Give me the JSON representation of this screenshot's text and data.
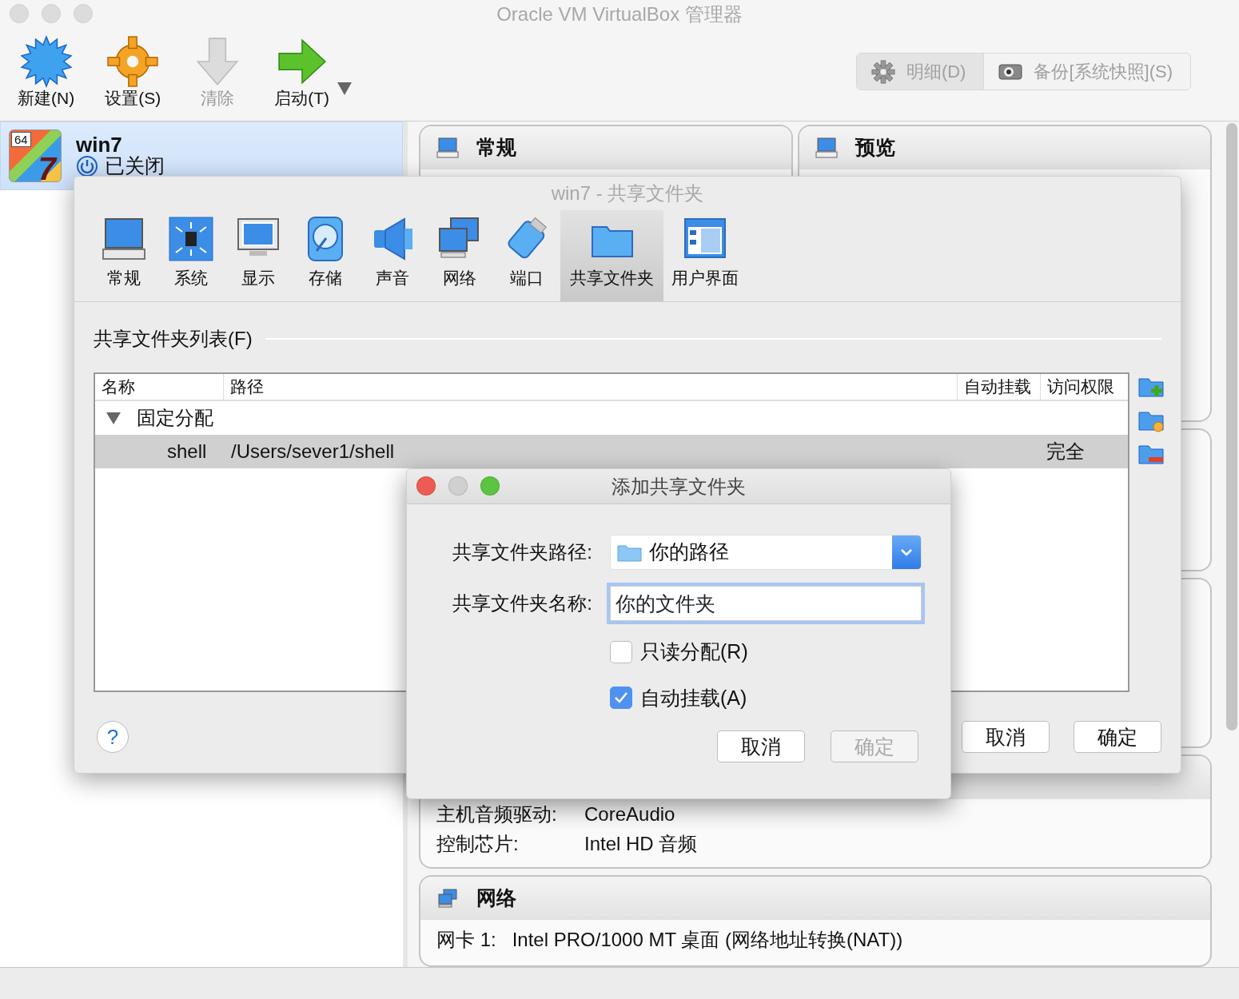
{
  "window": {
    "title": "Oracle VM VirtualBox 管理器"
  },
  "toolbar": [
    {
      "label": "新建(N)",
      "disabled": false,
      "kind": "new"
    },
    {
      "label": "设置(S)",
      "disabled": false,
      "kind": "settings"
    },
    {
      "label": "清除",
      "disabled": true,
      "kind": "discard"
    },
    {
      "label": "启动(T)",
      "disabled": false,
      "kind": "start",
      "menu": true
    }
  ],
  "mode_tabs": [
    {
      "label": "明细(D)",
      "selected": true,
      "kind": "gear"
    },
    {
      "label": "备份[系统快照](S)",
      "selected": false,
      "kind": "camera"
    }
  ],
  "vm_list": [
    {
      "name": "win7",
      "badge": "64",
      "logo": "7",
      "state": "已关闭",
      "selected": true
    }
  ],
  "details": {
    "general": {
      "title": "常规"
    },
    "preview": {
      "title": "预览"
    },
    "audio": {
      "rows": [
        {
          "label": "主机音频驱动:",
          "value": "CoreAudio"
        },
        {
          "label": "控制芯片:",
          "value": "Intel HD 音频"
        }
      ]
    },
    "network": {
      "title": "网络",
      "rows": [
        {
          "label": "网卡 1:",
          "value": "Intel PRO/1000 MT 桌面 (网络地址转换(NAT))"
        }
      ]
    }
  },
  "settings_dialog": {
    "title": "win7 - 共享文件夹",
    "sections": [
      {
        "label": "常规",
        "selected": false,
        "kind": "general"
      },
      {
        "label": "系统",
        "selected": false,
        "kind": "system"
      },
      {
        "label": "显示",
        "selected": false,
        "kind": "display"
      },
      {
        "label": "存储",
        "selected": false,
        "kind": "storage"
      },
      {
        "label": "声音",
        "selected": false,
        "kind": "audio"
      },
      {
        "label": "网络",
        "selected": false,
        "kind": "network"
      },
      {
        "label": "端口",
        "selected": false,
        "kind": "ports"
      },
      {
        "label": "共享文件夹",
        "selected": true,
        "kind": "shared"
      },
      {
        "label": "用户界面",
        "selected": false,
        "kind": "ui"
      }
    ],
    "list_title": "共享文件夹列表(F)",
    "columns": [
      "名称",
      "路径",
      "自动挂载",
      "访问权限"
    ],
    "groups": [
      {
        "label": "固定分配",
        "expanded": true,
        "rows": [
          {
            "name": "shell",
            "path": "/Users/sever1/shell",
            "access": "完全",
            "selected": true
          }
        ]
      }
    ],
    "help": "?",
    "buttons": [
      "取消",
      "确定"
    ]
  },
  "add_dialog": {
    "title": "添加共享文件夹",
    "fields": [
      {
        "label": "共享文件夹路径:",
        "kind": "combo",
        "value": "你的路径",
        "focused": false
      },
      {
        "label": "共享文件夹名称:",
        "kind": "text",
        "value": "你的文件夹",
        "focused": true
      }
    ],
    "options": [
      {
        "label": "只读分配(R)",
        "checked": false
      },
      {
        "label": "自动挂载(A)",
        "checked": true
      }
    ],
    "buttons": [
      {
        "label": "取消",
        "disabled": false
      },
      {
        "label": "确定",
        "disabled": true
      }
    ]
  }
}
